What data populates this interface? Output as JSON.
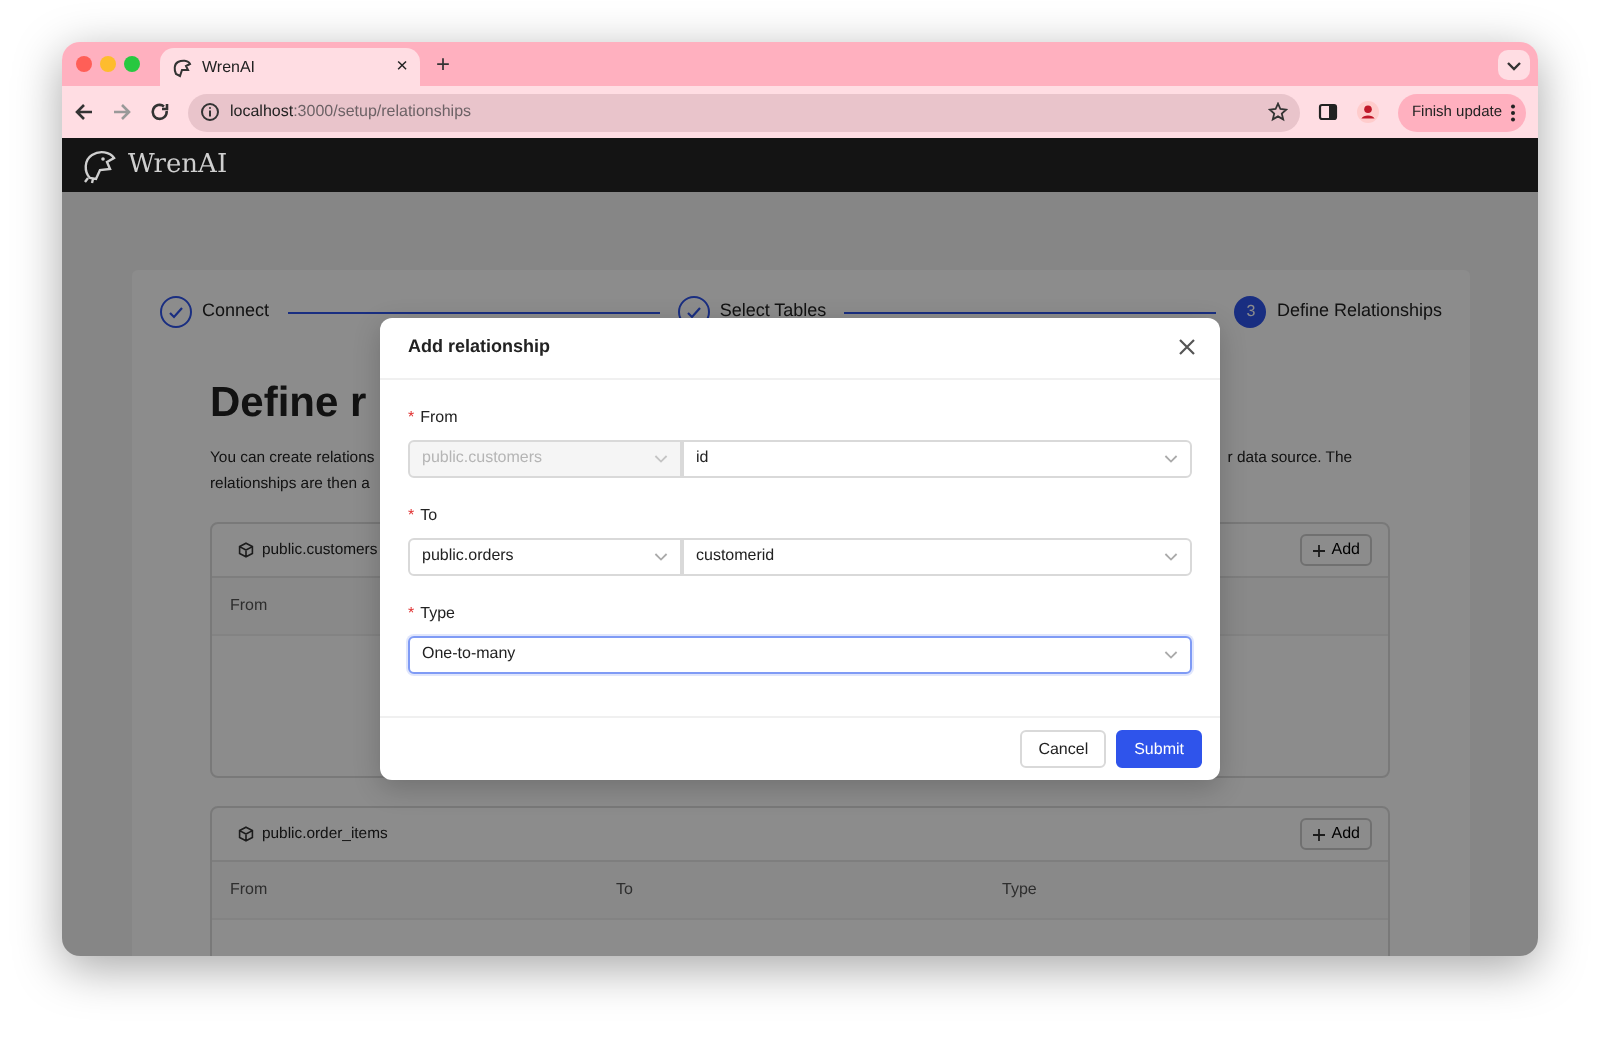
{
  "browser": {
    "tab_title": "WrenAI",
    "tab_close": "×",
    "new_tab": "+",
    "url_host": "localhost",
    "url_path": ":3000/setup/relationships",
    "update_button": "Finish update"
  },
  "app": {
    "logo_text": "WrenAI"
  },
  "steps": [
    {
      "label": "Connect",
      "kind": "done"
    },
    {
      "label": "Select Tables",
      "kind": "done"
    },
    {
      "number": "3",
      "label": "Define Relationships",
      "kind": "current"
    }
  ],
  "page": {
    "heading": "Define r",
    "description_lines": [
      [
        "You can create relations",
        "r data source. The"
      ],
      [
        "relationships are then a"
      ]
    ]
  },
  "models": [
    {
      "name": "public.customers",
      "add_label": "Add",
      "columns": [
        "From"
      ]
    },
    {
      "name": "public.order_items",
      "add_label": "Add",
      "columns": [
        "From",
        "To",
        "Type"
      ]
    }
  ],
  "modal": {
    "title": "Add relationship",
    "fields": [
      {
        "required_mark": "*",
        "label": "From",
        "controls": [
          {
            "value": "public.customers",
            "disabled": true,
            "focused": false
          },
          {
            "value": "id",
            "disabled": false,
            "focused": false
          }
        ]
      },
      {
        "required_mark": "*",
        "label": "To",
        "controls": [
          {
            "value": "public.orders",
            "disabled": false,
            "focused": false
          },
          {
            "value": "customerid",
            "disabled": false,
            "focused": false
          }
        ]
      },
      {
        "required_mark": "*",
        "label": "Type",
        "controls": [
          {
            "value": "One-to-many",
            "disabled": false,
            "focused": true
          }
        ]
      }
    ],
    "buttons": [
      {
        "label": "Cancel",
        "primary": false
      },
      {
        "label": "Submit",
        "primary": true
      }
    ]
  }
}
